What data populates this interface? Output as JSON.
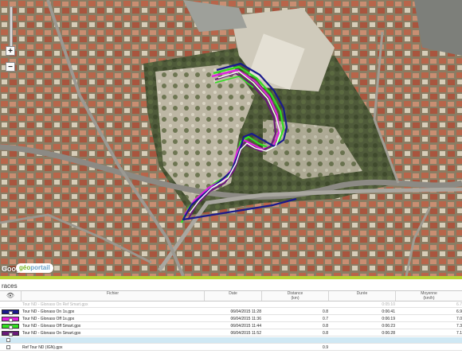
{
  "map": {
    "zoom_in_label": "+",
    "zoom_out_label": "−",
    "google_label": "Google",
    "geoportail_prefix": "géo",
    "geoportail_suffix": "portail"
  },
  "panel": {
    "title": "races",
    "columns": {
      "visible": "",
      "file": "Fichier",
      "date": "Date",
      "distance": "Distance",
      "distance_unit": "(km)",
      "duration": "Durée",
      "speed": "Moyenne",
      "speed_unit": "(km/h)"
    },
    "rows": [
      {
        "color": "",
        "file": "Tour ND - Glonass On Ref Smart.gpx",
        "date": "",
        "distance": "",
        "duration": "0:05:10",
        "speed": "6.7",
        "ghost": true
      },
      {
        "color": "#1a1a8c",
        "file": "Tour ND - Glonass On 1s.gpx",
        "date": "06/04/2015 11:28",
        "distance": "0.8",
        "duration": "0:06:41",
        "speed": "6.9"
      },
      {
        "color": "#e020e0",
        "file": "Tour ND - Glonass Off 1s.gpx",
        "date": "06/04/2015 11:36",
        "distance": "0.7",
        "duration": "0:06:19",
        "speed": "7.0"
      },
      {
        "color": "#30e020",
        "file": "Tour ND - Glonass Off Smart.gpx",
        "date": "06/04/2015 11:44",
        "distance": "0.8",
        "duration": "0:06:23",
        "speed": "7.3"
      },
      {
        "color": "#6a1a7a",
        "file": "Tour ND - Glonass On Smart.gpx",
        "date": "06/04/2015 11:52",
        "distance": "0.8",
        "duration": "0:06:28",
        "speed": "7.1"
      },
      {
        "color": "",
        "file": "",
        "date": "",
        "distance": "",
        "duration": "",
        "speed": "",
        "selected": true
      },
      {
        "color": "",
        "file": "Ref Tour ND (IGN).gpx",
        "date": "",
        "distance": "0.9",
        "duration": "",
        "speed": ""
      }
    ]
  }
}
